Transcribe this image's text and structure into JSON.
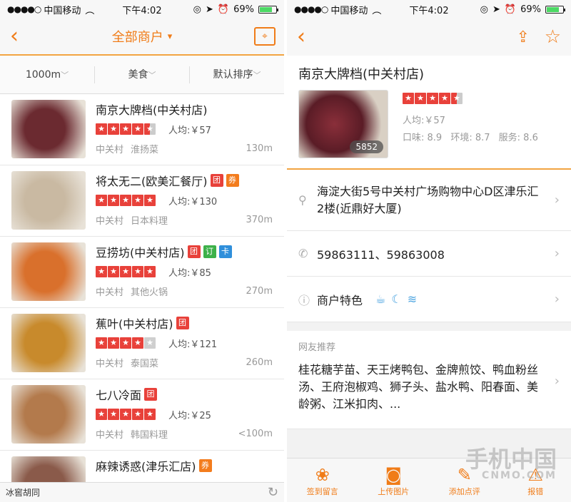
{
  "status_bar": {
    "carrier": "中国移动",
    "time": "下午4:02",
    "battery": "69%",
    "battery_level": 0.69
  },
  "left": {
    "nav": {
      "title": "全部商户"
    },
    "filters": [
      "1000m",
      "美食",
      "默认排序"
    ],
    "items": [
      {
        "name": "南京大牌档(中关村店)",
        "tags": [],
        "stars": 4.5,
        "price": "人均:￥57",
        "area": "中关村",
        "category": "淮扬菜",
        "distance": "130m",
        "thumb": "#6b2a30"
      },
      {
        "name": "将太无二(欧美汇餐厅)",
        "tags": [
          "团",
          "券"
        ],
        "stars": 5,
        "price": "人均:￥130",
        "area": "中关村",
        "category": "日本料理",
        "distance": "370m",
        "thumb": "#c9b9a2"
      },
      {
        "name": "豆捞坊(中关村店)",
        "tags": [
          "团",
          "订",
          "卡"
        ],
        "stars": 5,
        "price": "人均:￥85",
        "area": "中关村",
        "category": "其他火锅",
        "distance": "270m",
        "thumb": "#d9702c"
      },
      {
        "name": "蕉叶(中关村店)",
        "tags": [
          "团"
        ],
        "stars": 4,
        "price": "人均:￥121",
        "area": "中关村",
        "category": "泰国菜",
        "distance": "260m",
        "thumb": "#c88a2c"
      },
      {
        "name": "七八冷面",
        "tags": [
          "团"
        ],
        "stars": 5,
        "price": "人均:￥25",
        "area": "中关村",
        "category": "韩国料理",
        "distance": "<100m",
        "thumb": "#b37a4c"
      },
      {
        "name": "麻辣诱惑(津乐汇店)",
        "tags": [
          "券"
        ],
        "stars": 5,
        "price": "",
        "area": "",
        "category": "",
        "distance": "",
        "thumb": "#8a5a4a"
      }
    ],
    "bottom_text": "冰窖胡同"
  },
  "right": {
    "title": "南京大牌档(中关村店)",
    "photo_count": "5852",
    "stars": 4.5,
    "price": "人均:￥57",
    "scores": [
      "口味: 8.9",
      "环境: 8.7",
      "服务: 8.6"
    ],
    "address": "海淀大街5号中关村广场购物中心D区津乐汇2楼(近鼎好大厦)",
    "phone": "59863111、59863008",
    "feature_label": "商户特色",
    "rec_label": "网友推荐",
    "rec_text": "桂花糖芋苗、天王烤鸭包、金牌煎饺、鸭血粉丝汤、王府泡椒鸡、狮子头、盐水鸭、阳春面、美龄粥、江米扣肉、...",
    "tabs": [
      "签到留言",
      "上传图片",
      "添加点评",
      "报错"
    ]
  },
  "watermark": {
    "line1": "手机中国",
    "line2": "CNMO.COM"
  }
}
